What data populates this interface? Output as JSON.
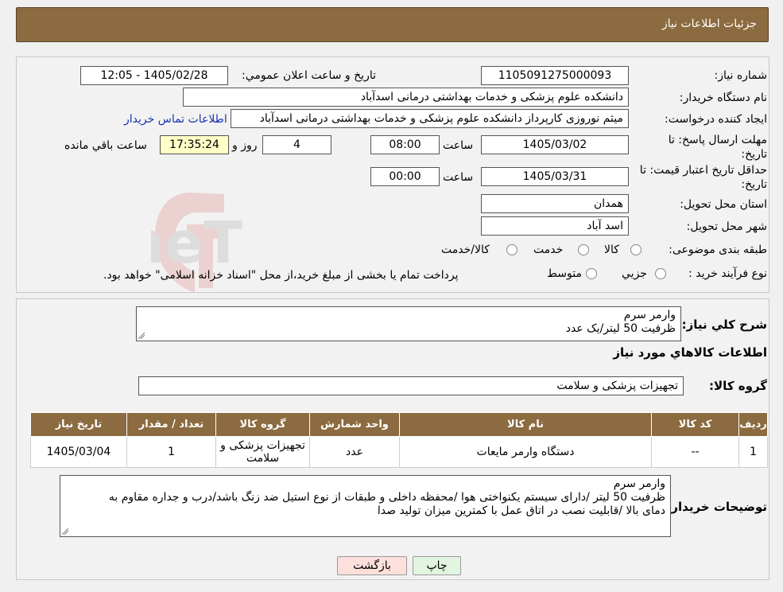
{
  "header": {
    "title": "جزئیات اطلاعات نیاز"
  },
  "form": {
    "need_number_label": "شماره نیاز:",
    "need_number": "1105091275000093",
    "announce_label": "تاریخ و ساعت اعلان عمومي:",
    "announce_value": "1405/02/28 - 12:05",
    "buyer_label": "نام دستگاه خريدار:",
    "buyer_value": "دانشکده علوم پزشکی و خدمات بهداشتی درمانی اسدآباد",
    "creator_label": "ايجاد کننده درخواست:",
    "creator_value": "میثم نوروزی کارپرداز دانشکده علوم پزشکی و خدمات بهداشتی درمانی اسدآباد",
    "contact_link": "اطلاعات تماس خريدار",
    "deadline_label_1": "مهلت ارسال پاسخ: تا",
    "deadline_label_2": "تاريخ:",
    "deadline_date": "1405/03/02",
    "time_label": "ساعت",
    "deadline_time": "08:00",
    "days_value": "4",
    "days_label": "روز و",
    "remaining_time": "17:35:24",
    "remaining_label": "ساعت باقي مانده",
    "validity_label_1": "حداقل تاريخ اعتبار قيمت: تا",
    "validity_label_2": "تاريخ:",
    "validity_date": "1405/03/31",
    "validity_time_label": "ساعت",
    "validity_time": "00:00",
    "province_label": "استان محل تحويل:",
    "province_value": "همدان",
    "city_label": "شهر محل تحويل:",
    "city_value": "اسد آباد",
    "category_label": "طبقه بندی موضوعی:",
    "category_options": [
      "کالا",
      "خدمت",
      "کالا/خدمت"
    ],
    "process_label": "نوع فرآيند خريد :",
    "process_options": [
      "جزيي",
      "متوسط"
    ],
    "process_note": "پرداخت تمام یا بخشی از مبلغ خرید،از محل \"اسناد خزانه اسلامی\" خواهد بود."
  },
  "summary": {
    "title_label": "شرح کلي نياز:",
    "description_lines": [
      "وارمر سرم",
      "ظرفیت 50 لیتر/یک عدد"
    ],
    "goods_info_label": "اطلاعات کالاهاي مورد نياز",
    "goods_group_label": "گروه کالا:",
    "goods_group_value": "تجهیزات پزشکی و سلامت"
  },
  "table": {
    "headers": [
      "رديف",
      "کد کالا",
      "نام کالا",
      "واحد شمارش",
      "گروه کالا",
      "تعداد / مقدار",
      "تاريخ نياز"
    ],
    "rows": [
      [
        "1",
        "--",
        "دستگاه وارمر مایعات",
        "عدد",
        "تجهیزات پزشکی و سلامت",
        "1",
        "1405/03/04"
      ]
    ]
  },
  "buyer_notes": {
    "label": "توضيحات خريدار:",
    "lines": [
      "وارمر سرم",
      "ظرفیت 50 لیتر /دارای سیستم یکنواختی هوا /محفظه داخلی و طبقات از نوع استیل ضد زنگ باشد/درب و جداره مقاوم به",
      "دمای بالا /قابلیت نصب در اتاق عمل با کمترین میزان تولید صدا"
    ]
  },
  "buttons": {
    "print": "چاپ",
    "back": "بازگشت"
  },
  "watermark": {
    "text": "AriaTender.neT"
  },
  "colors": {
    "header": "#8b6b3f",
    "link": "#1a33b0",
    "remaining_bg": "#ffffc6",
    "back_bg": "#fde0dc",
    "print_bg": "#e1f5e1"
  }
}
